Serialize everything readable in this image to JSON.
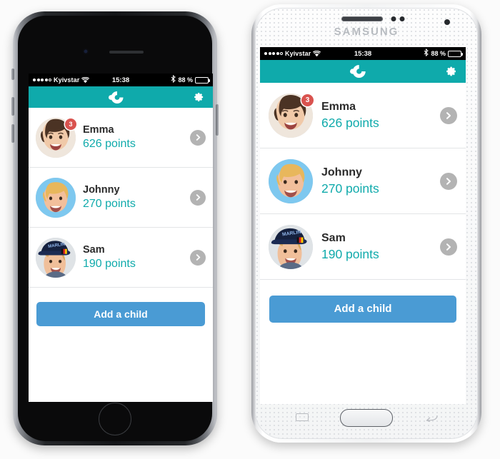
{
  "app": {
    "accent_teal": "#0faaab",
    "button_blue": "#4a9bd4",
    "badge_red": "#d9534f",
    "logo_name": "app-logo-circle-dot",
    "settings_label": "gear-icon"
  },
  "status_bar": {
    "carrier": "Kyivstar",
    "signal_dots_filled": 4,
    "signal_dots_total": 5,
    "wifi": "wifi-icon",
    "time": "15:38",
    "bluetooth": "bluetooth-icon",
    "battery_percent": "88 %",
    "battery_level": 88
  },
  "children": [
    {
      "name": "Emma",
      "points": "626 points",
      "badge": "3",
      "avatar": "girl-brown-hair-avatar"
    },
    {
      "name": "Johnny",
      "points": "270 points",
      "badge": "",
      "avatar": "boy-blond-hair-avatar"
    },
    {
      "name": "Sam",
      "points": "190 points",
      "badge": "",
      "avatar": "boy-blue-cap-avatar"
    }
  ],
  "add_child_button": "Add a child",
  "devices": {
    "iphone": {
      "name": "iPhone",
      "home_button": "home-button"
    },
    "samsung": {
      "name": "Samsung",
      "brand_text": "SAMSUNG",
      "home_button": "home-button"
    }
  }
}
